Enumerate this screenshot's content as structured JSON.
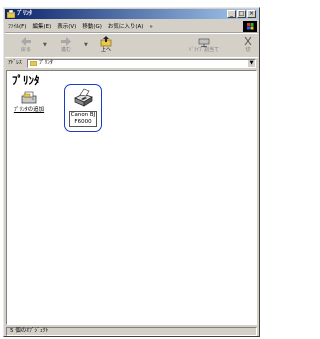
{
  "window": {
    "title": "ﾌﾟﾘﾝﾀ",
    "minimize": "_",
    "maximize": "□",
    "close": "×"
  },
  "menu": [
    "ﾌｧｲﾙ(F)",
    "編集(E)",
    "表示(V)",
    "移動(G)",
    "お気に入り(A)",
    "»"
  ],
  "toolbar": {
    "back": "戻る",
    "forward": "進む",
    "up": "上へ",
    "map_drive": "ﾄﾞﾗｲﾌﾞ割当て",
    "cut": "切"
  },
  "address": {
    "label": "ｱﾄﾞﾚｽ",
    "value": "ﾌﾟﾘﾝﾀ"
  },
  "content": {
    "heading": "ﾌﾟﾘﾝﾀ",
    "items": [
      {
        "label": "ﾌﾟﾘﾝﾀの追加"
      },
      {
        "label_line1": "Canon BJ",
        "label_line2": "F6000"
      }
    ]
  },
  "status": {
    "text": "5 個のｵﾌﾞｼﾞｪｸﾄ"
  },
  "colors": {
    "titlebar_start": "#0a246a",
    "titlebar_end": "#a6caf0",
    "selection_outline": "#1a3cc4",
    "chrome": "#d4d0c8"
  }
}
